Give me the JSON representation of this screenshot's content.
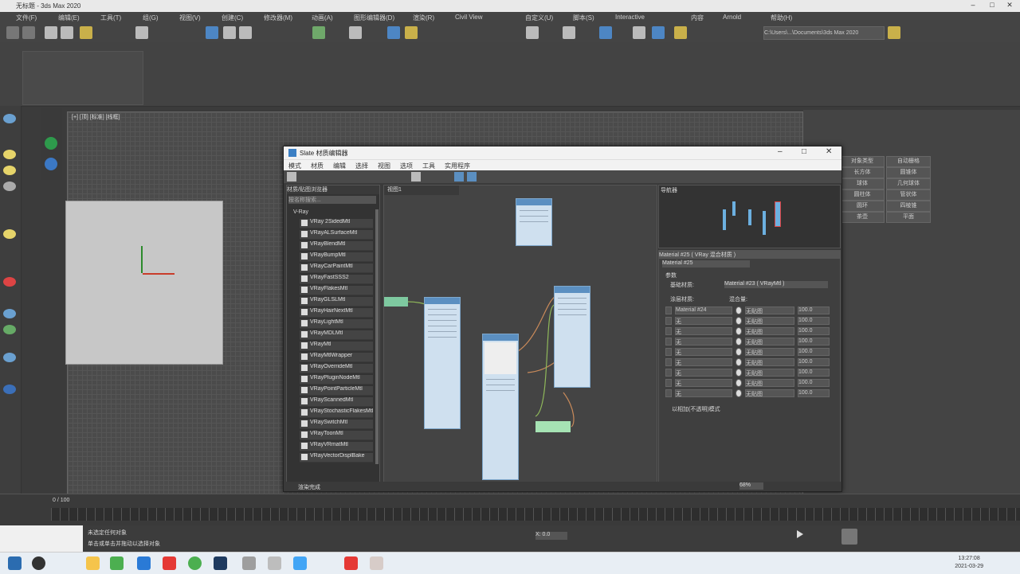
{
  "window": {
    "title": "无标题 - 3ds Max 2020"
  },
  "menubar": {
    "items": [
      "文件(F)",
      "编辑(E)",
      "工具(T)",
      "组(G)",
      "视图(V)",
      "创建(C)",
      "修改器(M)",
      "动画(A)",
      "图形编辑器(D)",
      "渲染(R)",
      "Civil View",
      "自定义(U)",
      "脚本(S)",
      "Interactive",
      "内容",
      "Arnold",
      "帮助(H)"
    ]
  },
  "toolbar": {
    "workspace_path": "C:\\Users\\...\\Documents\\3ds Max 2020"
  },
  "viewport": {
    "label": "[+] [顶] [标准] [线框]"
  },
  "slate": {
    "title": "Slate 材质编辑器",
    "menu": [
      "模式",
      "材质",
      "编辑",
      "选择",
      "视图",
      "选项",
      "工具",
      "实用程序"
    ],
    "browser_title": "材质/贴图浏览器",
    "browser_search": "按名称搜索...",
    "browser_section": "V-Ray",
    "browser_items": [
      "VRay 2SidedMtl",
      "VRayALSurfaceMtl",
      "VRayBlendMtl",
      "VRayBumpMtl",
      "VRayCarPaintMtl",
      "VRayFastSSS2",
      "VRayFlakesMtl",
      "VRayGLSLMtl",
      "VRayHairNextMtl",
      "VRayLightMtl",
      "VRayMDLMtl",
      "VRayMtl",
      "VRayMtlWrapper",
      "VRayOverrideMtl",
      "VRayPluginNodeMtl",
      "VRayPointParticleMtl",
      "VRayScannedMtl",
      "VRayStochasticFlakesMtl",
      "VRaySwitchMtl",
      "VRayToonMtl",
      "VRayVRmatMtl",
      "VRayVectorDisplBake"
    ],
    "view_tab": "视图1",
    "navigator_title": "导航器",
    "params_title": "Material #25 ( VRay 混合材质 )",
    "params_sub": "Material #25",
    "params_header": "参数",
    "base_label": "基础材质:",
    "base_value": "Material #23 ( VRayMtl )",
    "coat_label": "涂层材质:",
    "blend_label": "混合量:",
    "rows": [
      {
        "mat": "Material #24",
        "blend": "无贴图",
        "amt": "100.0"
      },
      {
        "mat": "无",
        "blend": "无贴图",
        "amt": "100.0"
      },
      {
        "mat": "无",
        "blend": "无贴图",
        "amt": "100.0"
      },
      {
        "mat": "无",
        "blend": "无贴图",
        "amt": "100.0"
      },
      {
        "mat": "无",
        "blend": "无贴图",
        "amt": "100.0"
      },
      {
        "mat": "无",
        "blend": "无贴图",
        "amt": "100.0"
      },
      {
        "mat": "无",
        "blend": "无贴图",
        "amt": "100.0"
      },
      {
        "mat": "无",
        "blend": "无贴图",
        "amt": "100.0"
      },
      {
        "mat": "无",
        "blend": "无贴图",
        "amt": "100.0"
      }
    ],
    "additive_label": "以相加(不透明)模式",
    "status": "渲染完成",
    "zoom": "68%"
  },
  "cmdpanel": {
    "buttons": [
      "对象类型",
      "自动栅格",
      "长方体",
      "圆锥体",
      "球体",
      "几何球体",
      "圆柱体",
      "管状体",
      "圆环",
      "四棱锥",
      "茶壶",
      "平面"
    ]
  },
  "timeline": {
    "frame": "0 / 100"
  },
  "status": {
    "selected": "未选定任何对象",
    "coord": "X: 0.0",
    "clock_time": "13:27:08",
    "clock_date": "2021-03-29",
    "hint": "单击或单击并拖动以选择对象"
  }
}
